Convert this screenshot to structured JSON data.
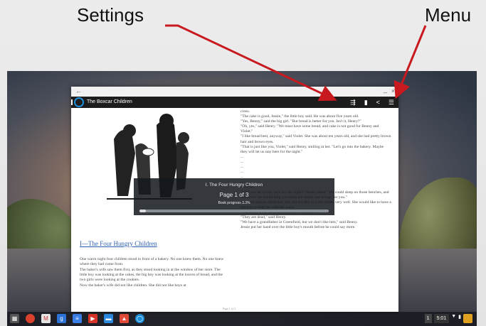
{
  "annotations": {
    "settings": "Settings",
    "menu": "Menu"
  },
  "window": {
    "titlebar": {
      "back": "←",
      "minimize": "_",
      "close": "×"
    },
    "app_title": "The Boxcar Children",
    "toolbar_icons": [
      "settings-icon",
      "bookmark-icon",
      "share-icon",
      "menu-icon"
    ]
  },
  "book": {
    "chapter_link": "I—The Four Hungry Children",
    "left_paragraphs": [
      "One warm night four children stood in front of a bakery. No one knew them. No one knew where they had come from.",
      "The baker's wife saw them first, as they stood looking in at the window of her store. The little boy was looking at the cakes, the big boy was looking at the loaves of bread, and the two girls were looking at the cookies.",
      "Now the baker's wife did not like children. She did not like boys at"
    ],
    "right_paragraphs": [
      "cross.",
      "\"The cake is good, Jessie,\" the little boy said. He was about five years old.",
      "\"Yes, Benny,\" said the big girl. \"But bread is better for you. Isn't it, Henry?\"",
      "\"Oh, yes,\" said Henry. \"We must have some bread, and cake is not good for Benny and Violet.\"",
      "\"I like bread best, anyway,\" said Violet. She was about ten years old, and she had pretty brown hair and brown eyes.",
      "\"That is just like you, Violet,\" said Henry, smiling at her. \"Let's go into the bakery. Maybe they will let us stay here for the night.\"",
      "...",
      "...",
      "...",
      "...",
      "...",
      "...",
      "on them.",
      "\"Will you let us stay here for the night?\" Jessie asked. \"We could sleep on those benches, and tomorrow we would help you wash the dishes and doings for you.\"",
      "Now the woman liked that. She did not like to wash dishes very well. She would like to have a big boy to help her with her work.",
      "\"Where are your father and mother?\" she asked.",
      "\"They are dead,\" said Henry.",
      "\"We have a grandfather in Greenfield, but we don't like him,\" said Benny.",
      "Jessie put her hand over the little boy's mouth before he could say more."
    ],
    "page_footer": "Page 1 of 3"
  },
  "overlay": {
    "chapter": "I. The Four Hungry Children",
    "page": "Page 1 of 3",
    "progress_label": "Book progress 3.3%",
    "progress": 0.033
  },
  "taskbar": {
    "apps": [
      "apps-launcher-icon",
      "chrome-icon",
      "gmail-icon",
      "google-plus-icon",
      "docs-icon",
      "youtube-icon",
      "files-icon",
      "photos-icon",
      "reader-icon"
    ],
    "tray_number": "1",
    "time": "5:01"
  }
}
